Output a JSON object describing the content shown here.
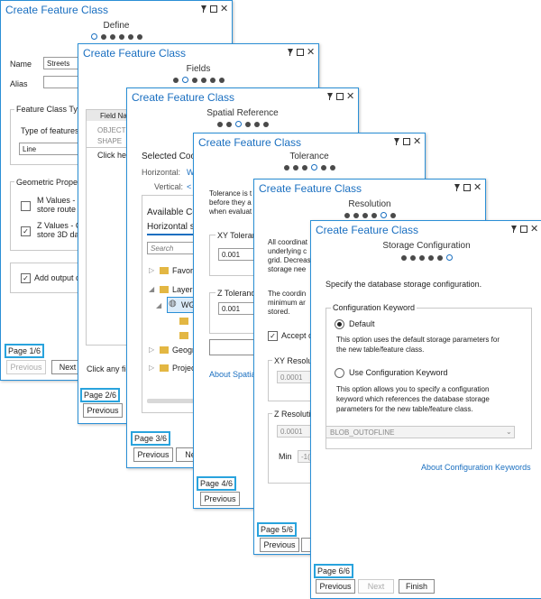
{
  "app_title": "Create Feature Class",
  "win1": {
    "step": "Define",
    "name_label": "Name",
    "name_value": "Streets",
    "alias_label": "Alias",
    "fc_type_label": "Feature Class Type",
    "type_label": "Type of features",
    "type_value": "Line",
    "geom_label": "Geometric Propert",
    "m_values": "M Values - C",
    "m_values2": "store route c",
    "z_values": "Z Values - C",
    "z_values2": "store 3D dat",
    "add_output": "Add output c",
    "page": "Page 1/6",
    "prev": "Previous",
    "next": "Next"
  },
  "win2": {
    "step": "Fields",
    "field_hdr": "Field Na",
    "field1": "OBJECTI",
    "field2": "SHAPE",
    "click_here": "Click her",
    "click_any": "Click any fie",
    "page": "Page 2/6",
    "prev": "Previous"
  },
  "win3": {
    "step": "Spatial Reference",
    "selected": "Selected Coo",
    "horizontal": "Horizontal:",
    "horizontal_val": "W",
    "vertical": "Vertical:",
    "vertical_val": "<",
    "available": "Available Co",
    "horizontal_tab": "Horizontal s",
    "search": "Search",
    "tree_fav": "Favori",
    "tree_layers": "Layers",
    "tree_wg": "WG",
    "tree_geog": "Geogr",
    "tree_proj": "Projec",
    "page": "Page 3/6",
    "prev": "Previous",
    "next": "Ne"
  },
  "win4": {
    "step": "Tolerance",
    "p1": "Tolerance is t",
    "p2": "before they a",
    "p3": "when evaluat",
    "xy_tol": "XY Toleranc",
    "xy_val": "0.001",
    "z_tol": "Z Toleranc",
    "z_val": "0.001",
    "about": "About Spatia",
    "page": "Page 4/6",
    "prev": "Previous"
  },
  "win5": {
    "step": "Resolution",
    "p1": "All coordinat",
    "p2": "underlying c",
    "p3": "grid. Decreas",
    "p4": "storage nee",
    "p5": "The coordin",
    "p6": "minimum ar",
    "p7": "stored.",
    "accept": "Accept c",
    "xy_res": "XY Resoluti",
    "xy_val": "0.0001",
    "z_res": "Z Resolutio",
    "z_val": "0.0001",
    "min": "Min",
    "min_val": "-1(",
    "page": "Page 5/6",
    "prev": "Previous"
  },
  "win6": {
    "step": "Storage Configuration",
    "intro": "Specify the database storage configuration.",
    "group": "Configuration Keyword",
    "default": "Default",
    "default_desc1": "This option uses the default storage parameters for",
    "default_desc2": "the new table/feature class.",
    "use_kw": "Use Configuration Keyword",
    "use_desc1": "This option allows you to specify a configuration",
    "use_desc2": "keyword which references the database storage",
    "use_desc3": "parameters for the new table/feature class.",
    "keyword_value": "BLOB_OUTOFLINE",
    "about": "About Configuration Keywords",
    "page": "Page 6/6",
    "prev": "Previous",
    "next": "Next",
    "finish": "Finish"
  }
}
